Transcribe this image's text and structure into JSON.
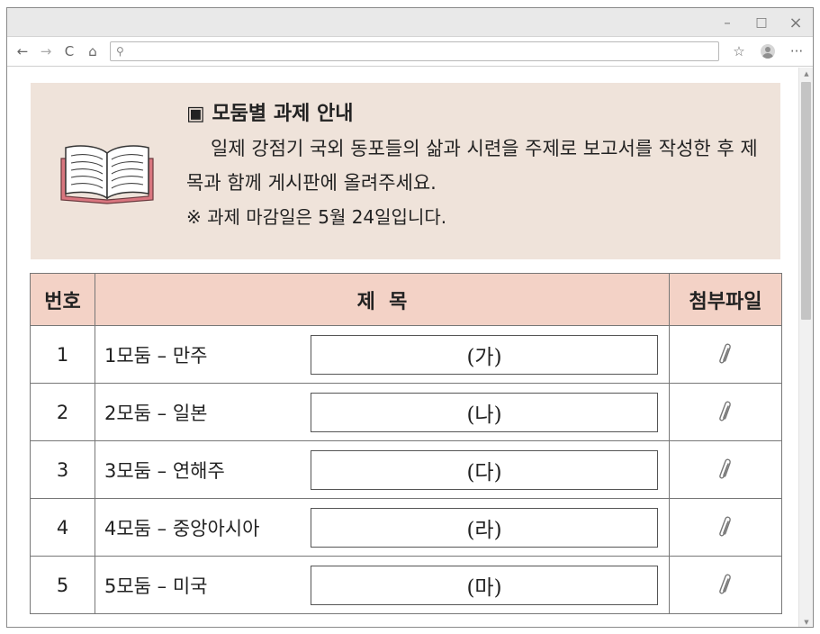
{
  "window": {
    "controls": {
      "minimize": "–",
      "maximize": "□",
      "close": "×"
    }
  },
  "toolbar": {
    "back": "←",
    "forward": "→",
    "refresh": "C",
    "home": "⌂",
    "search_glyph": "⚲",
    "favorites": "☆",
    "more": "···",
    "address_value": ""
  },
  "notice": {
    "title": "▣ 모둠별 과제 안내",
    "body": "일제 강점기 국외 동포들의 삶과 시련을 주제로 보고서를 작성한 후 제목과 함께 게시판에 올려주세요.",
    "note": "※ 과제 마감일은 5월 24일입니다."
  },
  "table": {
    "headers": {
      "num": "번호",
      "title": "제  목",
      "attachment": "첨부파일"
    },
    "rows": [
      {
        "num": "1",
        "group": "1모둠 – 만주",
        "answer": "(가)"
      },
      {
        "num": "2",
        "group": "2모둠 – 일본",
        "answer": "(나)"
      },
      {
        "num": "3",
        "group": "3모둠 – 연해주",
        "answer": "(다)"
      },
      {
        "num": "4",
        "group": "4모둠 – 중앙아시아",
        "answer": "(라)"
      },
      {
        "num": "5",
        "group": "5모둠 – 미국",
        "answer": "(마)"
      }
    ]
  },
  "icons": {
    "book": "open-book-icon",
    "attachment": "paperclip-icon"
  },
  "colors": {
    "notice_bg": "#efe3da",
    "header_bg": "#f3d2c6",
    "book_cover": "#d9767f"
  }
}
